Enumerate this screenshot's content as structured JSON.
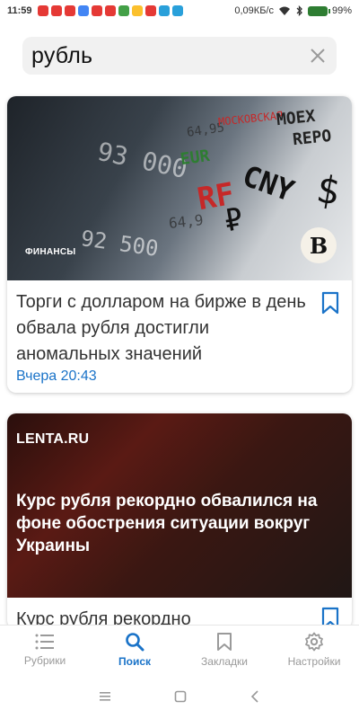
{
  "status_bar": {
    "time": "11:59",
    "network_speed": "0,09КБ/с",
    "battery_percent": "99%",
    "icons": [
      "youtube-icon",
      "youtube-icon",
      "mail-icon",
      "google-icon",
      "youtube-icon",
      "youtube-icon",
      "store-icon",
      "gallery-icon",
      "youtube-icon",
      "telegram-icon",
      "telegram-icon",
      "wifi-icon",
      "bluetooth-icon",
      "battery-icon"
    ]
  },
  "search": {
    "query": "рубль",
    "clear_icon": "close-icon"
  },
  "articles": [
    {
      "category": "ФИНАНСЫ",
      "source_logo": "B",
      "title": "Торги с долларом на бирже в день обвала рубля достигли аномальных значений",
      "time": "Вчера 20:43",
      "image_text": [
        "93 000",
        "92 500",
        "64,95",
        "64,9",
        "МОСКОВСКАЯ",
        "MOEX",
        "REPO",
        "CNY",
        "$",
        "₽",
        "EUR",
        "RF"
      ]
    },
    {
      "source_logo": "LENTA.RU",
      "image_title": "Курс рубля рекордно обвалился на фоне обострения ситуации вокруг Украины",
      "title_partial": "Курс рубля рекордно"
    }
  ],
  "bottom_nav": {
    "items": [
      {
        "label": "Рубрики",
        "icon": "list-icon",
        "active": false
      },
      {
        "label": "Поиск",
        "icon": "search-icon",
        "active": true
      },
      {
        "label": "Закладки",
        "icon": "bookmark-icon",
        "active": false
      },
      {
        "label": "Настройки",
        "icon": "gear-icon",
        "active": false
      }
    ]
  },
  "colors": {
    "accent": "#1a73c8",
    "inactive": "#9a9a9a",
    "search_bg": "#f1f1f1"
  }
}
